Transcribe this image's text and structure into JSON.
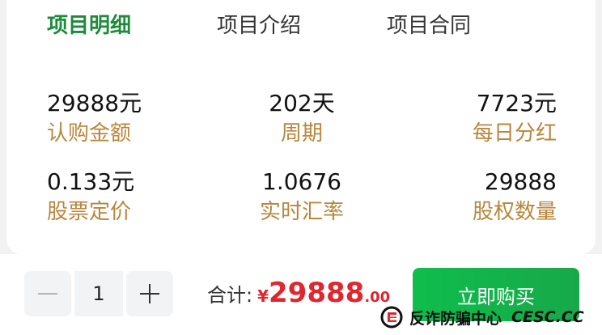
{
  "tabs": [
    {
      "label": "项目明细",
      "active": true
    },
    {
      "label": "项目介绍",
      "active": false
    },
    {
      "label": "项目合同",
      "active": false
    }
  ],
  "stats": {
    "subscription": {
      "value": "29888元",
      "label": "认购金额"
    },
    "period": {
      "value": "202天",
      "label": "周期"
    },
    "daily_dividend": {
      "value": "7723元",
      "label": "每日分红"
    },
    "share_price": {
      "value": "0.133元",
      "label": "股票定价"
    },
    "exchange_rate": {
      "value": "1.0676",
      "label": "实时汇率"
    },
    "equity_quantity": {
      "value": "29888",
      "label": "股权数量"
    }
  },
  "footer": {
    "quantity": "1",
    "total_label": "合计:",
    "currency": "¥",
    "total_integer": "29888",
    "total_decimal": ".00",
    "buy_label": "立即购买"
  },
  "watermark": {
    "text": "反诈防骗中心",
    "domain": "CESC.CC"
  },
  "colors": {
    "active_tab": "#1e8a3c",
    "stat_label": "#b8863c",
    "price": "#e0262f",
    "buy_button": "#0fbd4c"
  },
  "icons": [
    "minus-icon",
    "plus-icon",
    "cesc-logo-icon"
  ]
}
